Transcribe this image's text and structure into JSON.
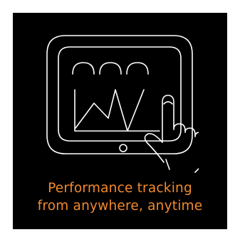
{
  "illustration": {
    "icon": "tablet-performance-chart-touch-icon"
  },
  "caption": {
    "line1": "Performance tracking",
    "line2": "from anywhere, anytime"
  },
  "colors": {
    "background": "#000000",
    "line_art": "#ffffff",
    "caption_text": "#f28a2e"
  }
}
